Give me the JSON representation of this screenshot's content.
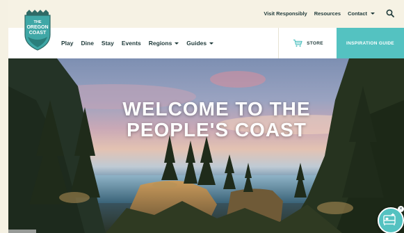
{
  "utility_nav": {
    "visit_responsibly": "Visit Responsibly",
    "resources": "Resources",
    "contact": "Contact"
  },
  "logo": {
    "line1": "THE",
    "line2": "OREGON",
    "line3": "COAST"
  },
  "main_nav": {
    "items": [
      "Play",
      "Dine",
      "Stay",
      "Events",
      "Regions",
      "Guides"
    ]
  },
  "store": {
    "label": "STORE"
  },
  "cta": {
    "label": "INSPIRATION GUIDE"
  },
  "hero": {
    "headline_line1": "WELCOME TO THE",
    "headline_line2": "PEOPLE'S COAST"
  },
  "colors": {
    "teal": "#54c2c1",
    "cream": "#f6f2e4",
    "dark_text": "#1f3a3a"
  }
}
